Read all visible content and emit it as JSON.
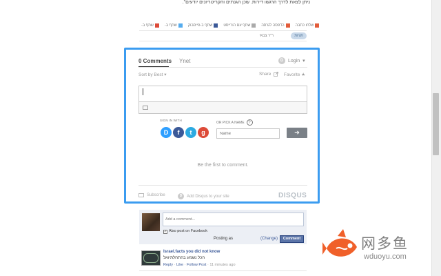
{
  "article": {
    "text": "ניתן לצאת לדרך הרגשו דירות. שכן הגנתים והקריטריונים יודעים\"."
  },
  "share_row": {
    "items": [
      {
        "label": "שלחו כתבה",
        "color": "#e25c3a"
      },
      {
        "label": "הדפסה לגרסה",
        "color": "#e25c3a"
      },
      {
        "label": "שתף עם הורייסט",
        "color": "#aaaaaa"
      },
      {
        "label": "שתף ב-פייסבוק",
        "color": "#3b5998"
      },
      {
        "label": "שתף ב-",
        "color": "#55acee"
      },
      {
        "label": "שתף ב-",
        "color": "#dd4b39"
      }
    ]
  },
  "tags": {
    "pill": "תגיות",
    "text": "ר\"ר צבאי"
  },
  "disqus": {
    "tab_comments": "0 Comments",
    "tab_site": "Ynet",
    "login": "Login",
    "login_caret": "▾",
    "sort": "Sort by Best",
    "sort_caret": "▾",
    "share": "Share",
    "favorite": "Favorite",
    "favorite_icon": "★",
    "signin_label": "SIGN IN WITH",
    "or_pick": "OR PICK A NAME",
    "qmark": "?",
    "name_placeholder": "Name",
    "submit_arrow": "➔",
    "empty_message": "Be the first to comment.",
    "subscribe": "Subscribe",
    "add_disqus": "Add Disqus to your site",
    "brand": "DISQUS",
    "disqus_letter": "D",
    "social": [
      {
        "letter": "D",
        "color": "#2e9fff",
        "name": "disqus"
      },
      {
        "letter": "f",
        "color": "#3b5998",
        "name": "facebook"
      },
      {
        "letter": "t",
        "color": "#2daae1",
        "name": "twitter"
      },
      {
        "letter": "g",
        "color": "#dd4b39",
        "name": "google"
      }
    ],
    "frame_color": "#3b9cf0"
  },
  "facebook": {
    "input_placeholder": "Add a comment...",
    "also_post_label": "Also post on Facebook",
    "checkbox_mark": "✓",
    "posting_as": "Posting as",
    "change": "(Change)",
    "comment_button": "Comment",
    "comment": {
      "author": "Israel.facts you did not know",
      "text": "הכל נשמע בהתחלתיואל",
      "reply": "Reply",
      "like": "Like",
      "follow": "Follow Post",
      "time": "11 minutes ago"
    }
  },
  "watermark": {
    "title": "网多鱼",
    "url": "wduoyu.com"
  }
}
